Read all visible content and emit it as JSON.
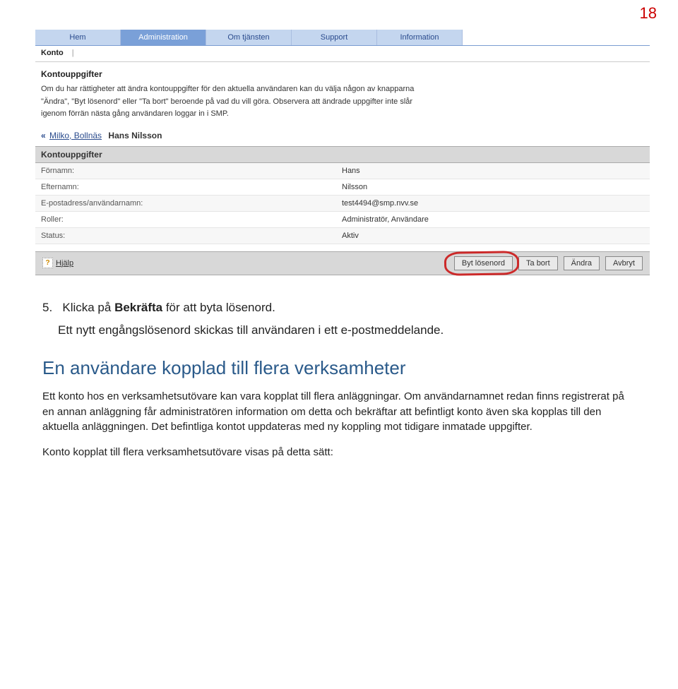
{
  "page_number": "18",
  "topnav": [
    "Hem",
    "Administration",
    "Om tjänsten",
    "Support",
    "Information"
  ],
  "topnav_active_index": 1,
  "subnav": {
    "item": "Konto"
  },
  "intro": {
    "title": "Kontouppgifter",
    "body": "Om du har rättigheter att ändra kontouppgifter för den aktuella användaren kan du välja någon av knapparna \"Ändra\", \"Byt lösenord\" eller \"Ta bort\" beroende på vad du vill göra. Observera att ändrade uppgifter inte slår igenom förrän nästa gång användaren loggar in i SMP."
  },
  "breadcrumb": {
    "back": "Milko, Bollnäs",
    "name": "Hans Nilsson"
  },
  "details": {
    "header": "Kontouppgifter",
    "rows": [
      {
        "label": "Förnamn:",
        "value": "Hans"
      },
      {
        "label": "Efternamn:",
        "value": "Nilsson"
      },
      {
        "label": "E-postadress/användarnamn:",
        "value": "test4494@smp.nvv.se"
      },
      {
        "label": "Roller:",
        "value": "Administratör, Användare"
      },
      {
        "label": "Status:",
        "value": "Aktiv"
      }
    ]
  },
  "actions": {
    "help": "Hjälp",
    "buttons": [
      "Byt lösenord",
      "Ta bort",
      "Ändra",
      "Avbryt"
    ]
  },
  "doc": {
    "step_num": "5.",
    "step_prefix": "Klicka på ",
    "step_bold": "Bekräfta",
    "step_suffix": " för att byta lösenord.",
    "step_sub": "Ett nytt engångslösenord skickas till användaren i ett e-postmeddelande.",
    "heading": "En användare kopplad till flera verksamheter",
    "para1": "Ett konto hos en verksamhetsutövare kan vara kopplat till flera anläggningar. Om användarnamnet redan finns registrerat på en annan anläggning får administratören information om detta och bekräftar att befintligt konto även ska kopplas till den aktuella anläggningen. Det befintliga kontot uppdateras med ny koppling mot tidigare inmatade uppgifter.",
    "para2": "Konto kopplat till flera verksamhetsutövare visas på detta sätt:"
  }
}
